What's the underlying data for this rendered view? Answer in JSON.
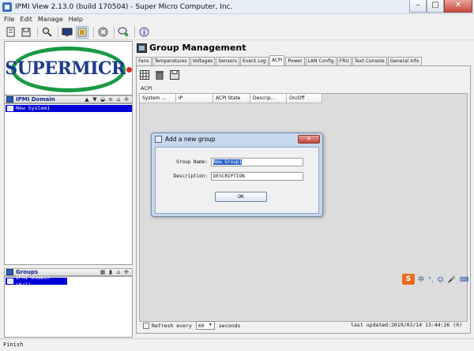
{
  "window": {
    "title": "IPMI View 2.13.0 (build 170504) - Super Micro Computer, Inc.",
    "minimize": "–",
    "maximize": "□",
    "close": "✕"
  },
  "menu": [
    "File",
    "Edit",
    "Manage",
    "Help"
  ],
  "logo": {
    "text": "SUPERMICR"
  },
  "ipmi_domain": {
    "title": "IPMI Domain",
    "selected_item": "New System1"
  },
  "groups": {
    "title": "Groups",
    "selected_item": "IPMI Domain (0/1)"
  },
  "right": {
    "title": "Group Management",
    "tabs": [
      "Fans",
      "Temperatures",
      "Voltages",
      "Sensors",
      "Event Log",
      "ACPI",
      "Power",
      "LAN Config",
      "FRU",
      "Text Console",
      "General Info"
    ],
    "active_tab": "ACPI",
    "section_label": "ACPI",
    "columns": [
      "System ...",
      "IP",
      "ACPI State",
      "Descrip...",
      "On/Off"
    ]
  },
  "refresh": {
    "label": "Refresh every",
    "interval": "60",
    "unit": "seconds"
  },
  "last_updated": "last updated:2019/02/14 13:44:26  (0)",
  "dialog": {
    "title": "Add a new group",
    "close": "✕",
    "group_name_label": "Group Name:",
    "group_name_value": "New Group1",
    "description_label": "Description:",
    "description_value": "DESCRIPTION",
    "ok": "OK"
  },
  "status": "Finish",
  "ime": {
    "s": "S",
    "lang": "中",
    "punct": "°,",
    "emoji": "☺",
    "mic": "🎤",
    "keyboard": "⌨"
  }
}
